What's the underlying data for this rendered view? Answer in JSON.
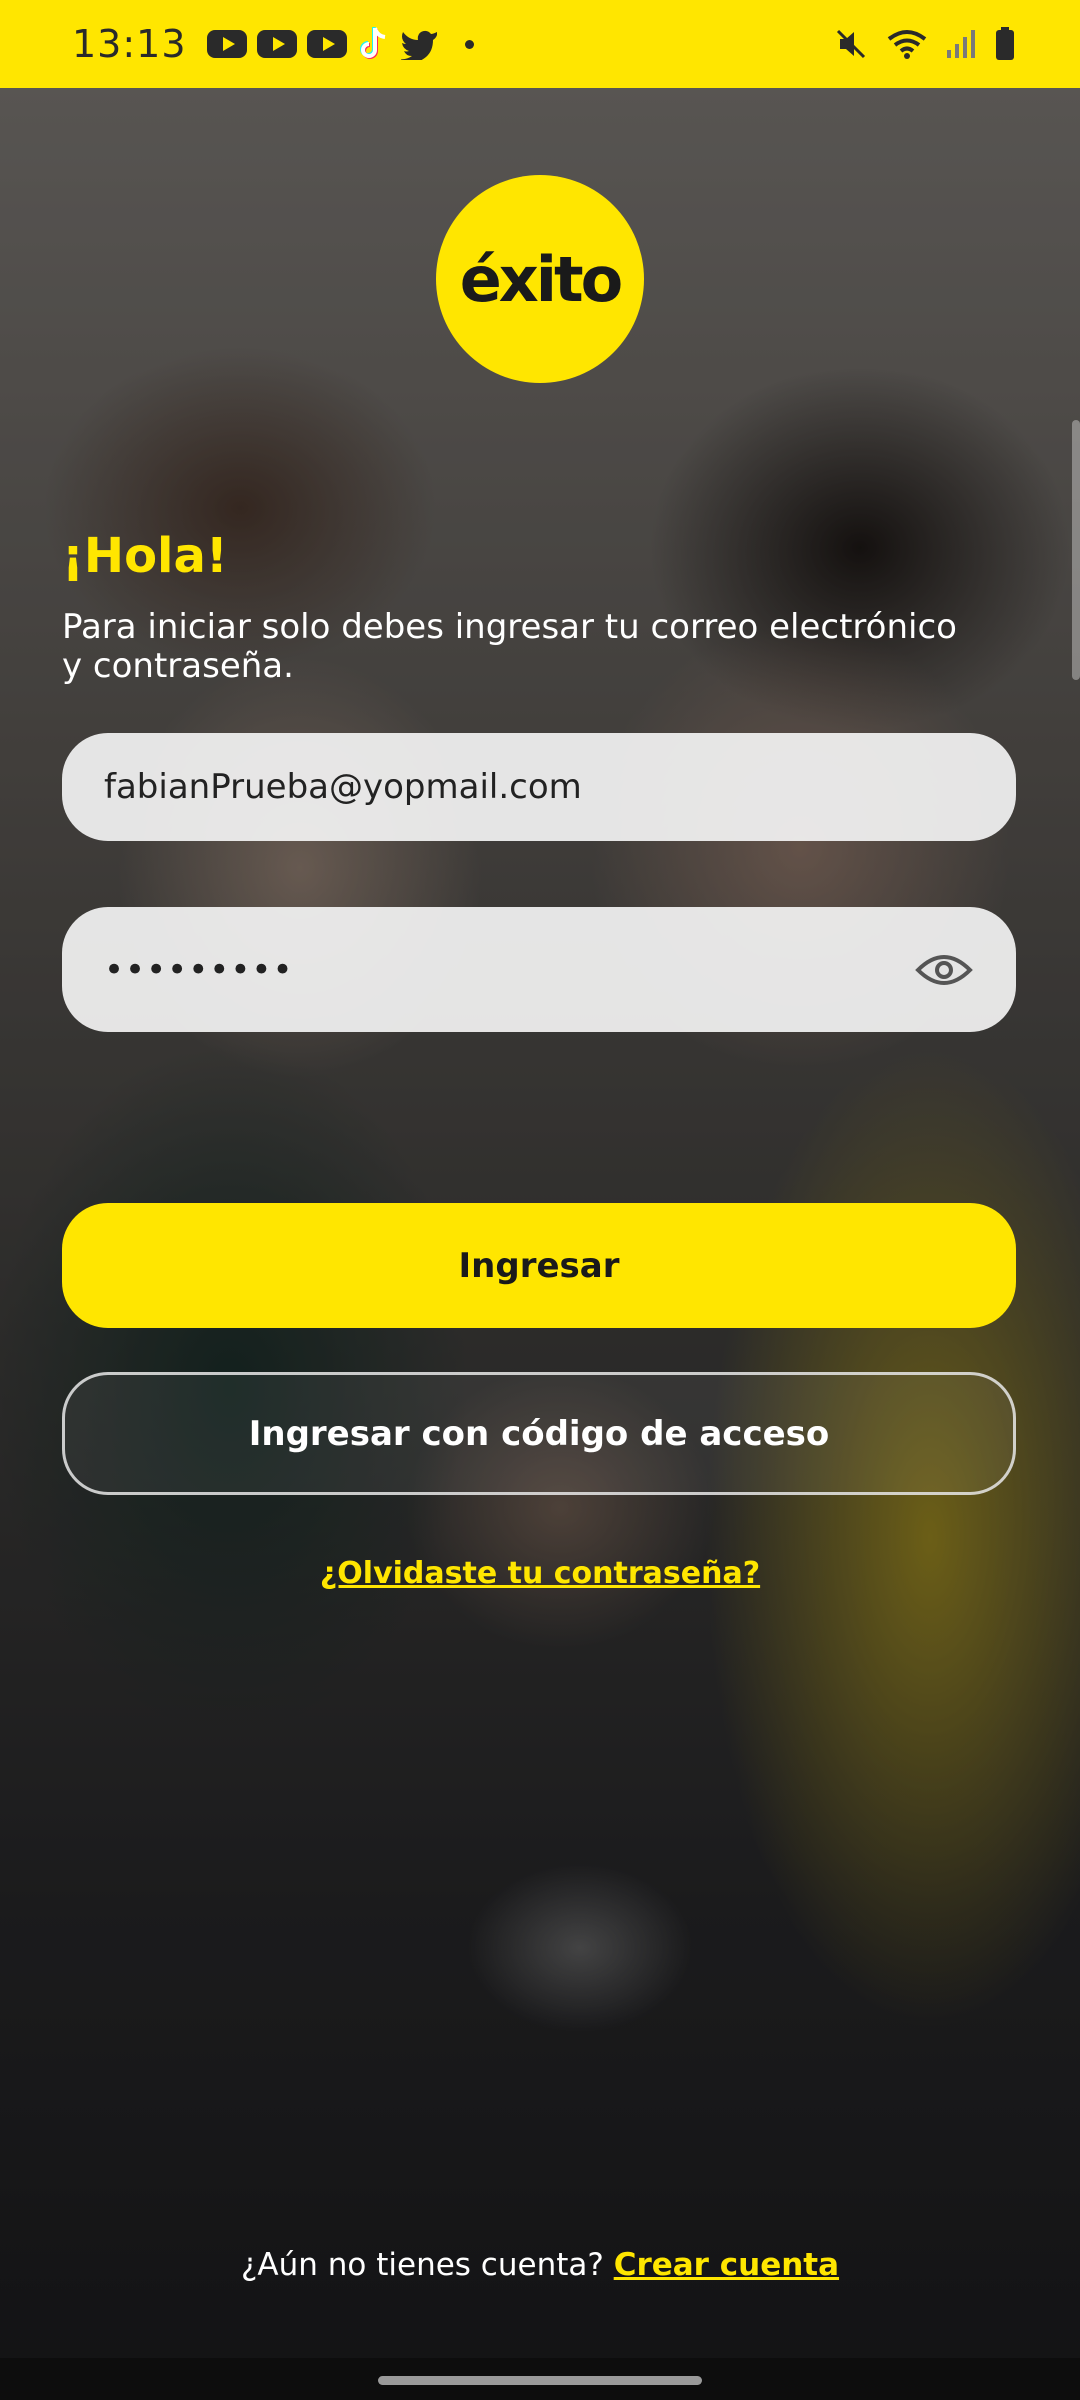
{
  "status_bar": {
    "time": "13:13",
    "left_icons": [
      "youtube-icon",
      "youtube-icon",
      "youtube-icon",
      "tiktok-icon",
      "twitter-icon",
      "dot-icon"
    ],
    "right_icons": [
      "mute-icon",
      "wifi-icon",
      "signal-icon",
      "battery-icon"
    ],
    "background": "#FFE600"
  },
  "logo": {
    "text": "éxito"
  },
  "login": {
    "greeting": "¡Hola!",
    "subtitle": "Para iniciar solo debes ingresar tu correo electrónico y contraseña.",
    "email_value": "fabianPrueba@yopmail.com",
    "password_value": "•••••••••",
    "login_button": "Ingresar",
    "code_button": "Ingresar con código de acceso",
    "forgot_link": "¿Olvidaste tu contraseña?",
    "signup_prompt": "¿Aún no tienes cuenta?",
    "signup_link": "Crear cuenta"
  },
  "colors": {
    "accent": "#FFE600",
    "text_dark": "#1a1a1a",
    "field_bg": "#F2F2F2"
  }
}
